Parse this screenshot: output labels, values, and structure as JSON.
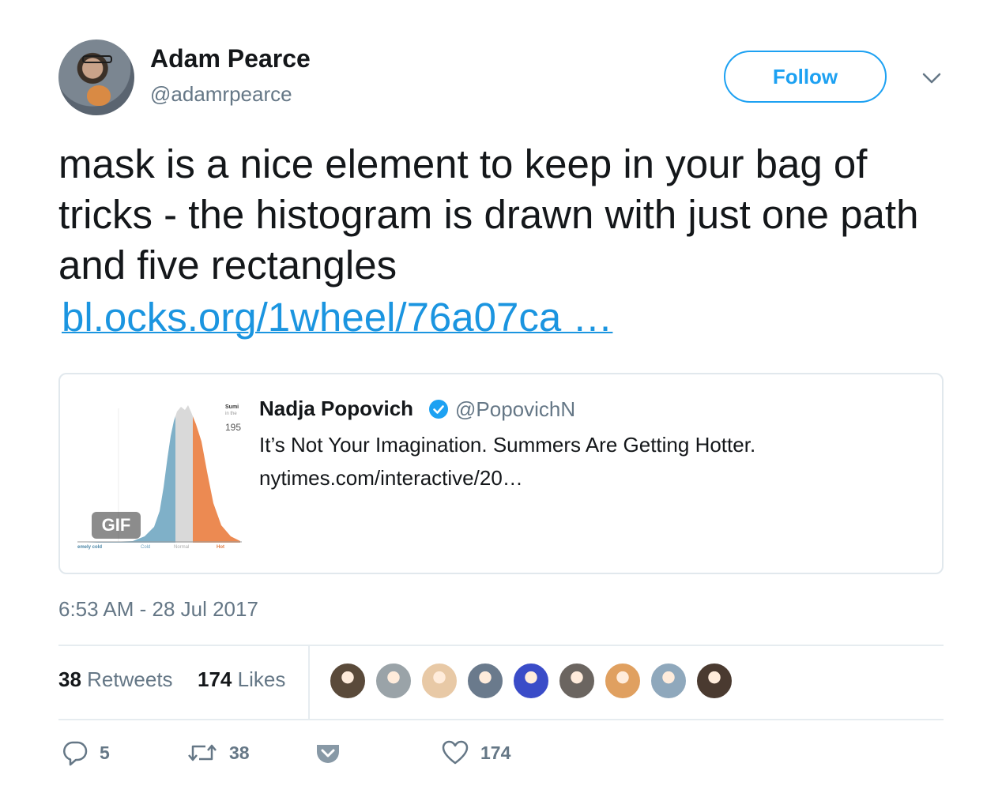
{
  "author": {
    "name": "Adam Pearce",
    "handle": "@adamrpearce",
    "avatar": "avatar-photo"
  },
  "follow_label": "Follow",
  "menu_icon": "chevron-down-icon",
  "tweet": {
    "text": "mask is a nice element to keep in your bag of tricks - the histogram is drawn with just one path and five rectangles",
    "link_text": "bl.ocks.org/1wheel/76a07ca …"
  },
  "quoted": {
    "name": "Nadja Popovich",
    "verified_icon": "verified-badge-icon",
    "handle": "@PopovichN",
    "text": "It’s Not Your Imagination. Summers Are Getting Hotter.",
    "link": "nytimes.com/interactive/20…",
    "thumbnail": {
      "gif_label": "GIF",
      "labels": [
        "emely cold",
        "Cold",
        "Normal",
        "Hot"
      ],
      "colors": {
        "cold": "#7fb0c8",
        "normal": "#d9d9d9",
        "hot": "#ec8a52"
      }
    }
  },
  "timestamp": "6:53 AM - 28 Jul 2017",
  "stats": {
    "retweets_count": "38",
    "retweets_label": "Retweets",
    "likes_count": "174",
    "likes_label": "Likes"
  },
  "likers": [
    {
      "name": "liker-avatar-1",
      "color": "#5a4a3a"
    },
    {
      "name": "liker-avatar-2",
      "color": "#9aa3a8"
    },
    {
      "name": "liker-avatar-3",
      "color": "#e8c9a6"
    },
    {
      "name": "liker-avatar-4",
      "color": "#6a7a8c"
    },
    {
      "name": "liker-avatar-5",
      "color": "#3a4cc8"
    },
    {
      "name": "liker-avatar-6",
      "color": "#6b6560"
    },
    {
      "name": "liker-avatar-7",
      "color": "#e0a060"
    },
    {
      "name": "liker-avatar-8",
      "color": "#8fa8bc"
    },
    {
      "name": "liker-avatar-9",
      "color": "#4a3a30"
    }
  ],
  "actions": {
    "reply_count": "5",
    "retweet_count": "38",
    "like_count": "174",
    "reply_icon": "reply-icon",
    "retweet_icon": "retweet-icon",
    "dm_icon": "pocket-icon",
    "like_icon": "heart-icon"
  },
  "colors": {
    "accent": "#1da1f2",
    "link": "#1b95e0",
    "muted": "#657786"
  }
}
